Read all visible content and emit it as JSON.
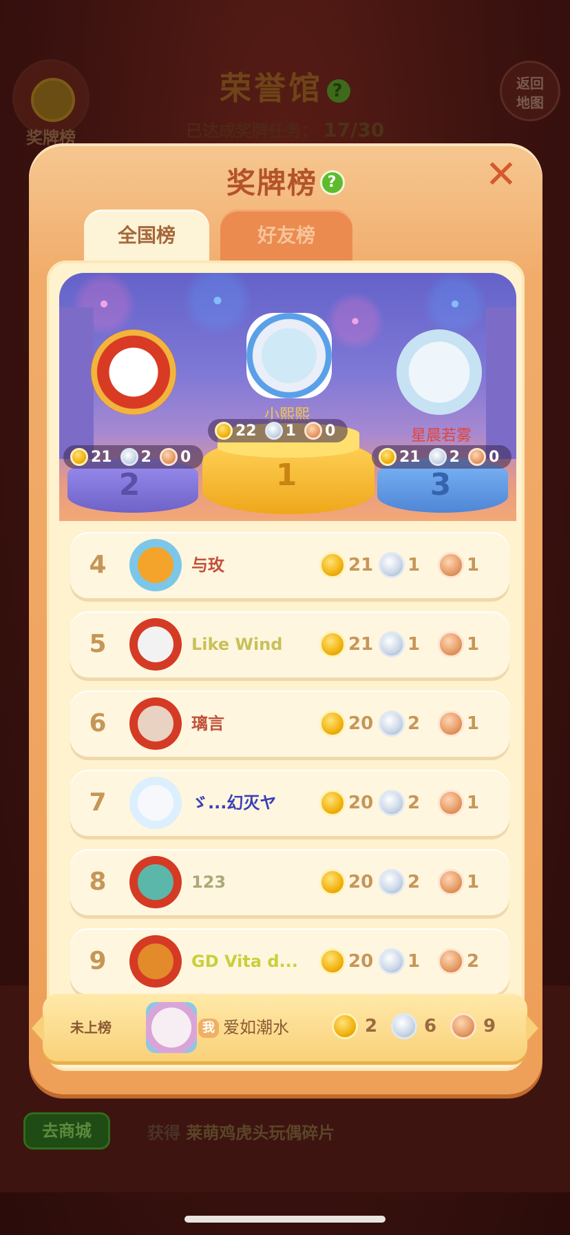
{
  "background": {
    "title": "荣誉馆",
    "task_label": "已达成奖牌任务：",
    "task_progress": "17/30",
    "medal_board_label": "奖牌榜",
    "back_map_label_1": "返回",
    "back_map_label_2": "地图",
    "shop_button": "去商城",
    "reward_prefix": "获得",
    "reward_item": "莱萌鸡虎头玩偶碎片"
  },
  "modal": {
    "title": "奖牌榜",
    "help": "?",
    "close": "✕",
    "tabs": [
      {
        "label": "全国榜",
        "active": true
      },
      {
        "label": "好友榜",
        "active": false
      }
    ]
  },
  "podium": [
    {
      "rank": "2",
      "name": "",
      "gold": "21",
      "silver": "2",
      "bronze": "0"
    },
    {
      "rank": "1",
      "name": "小熙熙",
      "gold": "22",
      "silver": "1",
      "bronze": "0"
    },
    {
      "rank": "3",
      "name": "星晨若雾",
      "gold": "21",
      "silver": "2",
      "bronze": "0"
    }
  ],
  "list": [
    {
      "rank": "4",
      "name": "与玫",
      "gold": "21",
      "silver": "1",
      "bronze": "1"
    },
    {
      "rank": "5",
      "name": "Like  Wind",
      "gold": "21",
      "silver": "1",
      "bronze": "1"
    },
    {
      "rank": "6",
      "name": "璃言",
      "gold": "20",
      "silver": "2",
      "bronze": "1"
    },
    {
      "rank": "7",
      "name": "ゞ...幻灭ヤ",
      "gold": "20",
      "silver": "2",
      "bronze": "1"
    },
    {
      "rank": "8",
      "name": "123",
      "gold": "20",
      "silver": "2",
      "bronze": "1"
    },
    {
      "rank": "9",
      "name": "GD Vita d...",
      "gold": "20",
      "silver": "1",
      "bronze": "2"
    }
  ],
  "me": {
    "status": "未上榜",
    "tag": "我",
    "name": "爱如潮水",
    "gold": "2",
    "silver": "6",
    "bronze": "9"
  },
  "colors": {
    "modal_bg": "#f1ac6a",
    "panel_bg": "#fff2cf",
    "rank_text": "#c69658",
    "title_text": "#b4532b"
  }
}
